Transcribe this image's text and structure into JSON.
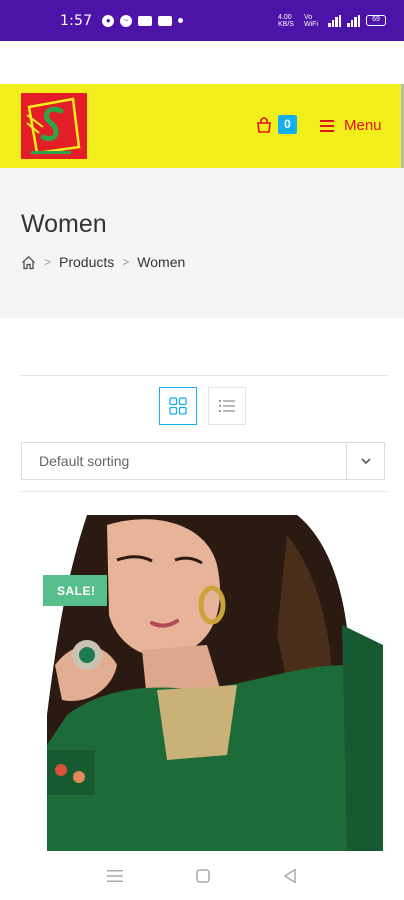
{
  "status_bar": {
    "time": "1:57",
    "right_text": "4.00 KB/S",
    "network": "Vo WiFi",
    "battery": "69"
  },
  "header": {
    "logo_name": "site-logo",
    "cart_count": "0",
    "menu_label": "Menu",
    "accent_color": "#e0121c",
    "background_color": "#f2ee1c"
  },
  "page": {
    "title": "Women",
    "breadcrumb": [
      "Products",
      "Women"
    ]
  },
  "shop": {
    "view_modes": [
      "grid",
      "list"
    ],
    "active_view": "grid",
    "sorting": "Default sorting"
  },
  "product": {
    "badge": "SALE!"
  },
  "icons": [
    "home-icon",
    "cart-icon",
    "menu-icon",
    "grid-view-icon",
    "list-view-icon",
    "chevron-down-icon"
  ]
}
